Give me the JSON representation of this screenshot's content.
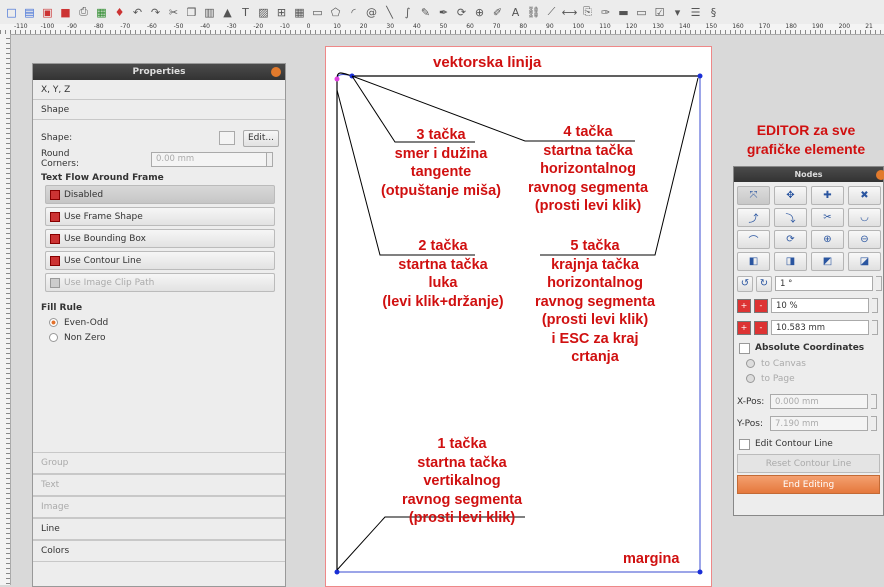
{
  "toolbar": {
    "icons": [
      "new-icon",
      "open-icon",
      "save-icon",
      "close-doc-icon",
      "print-icon",
      "preflight-icon",
      "pdf-icon",
      "undo-icon",
      "redo-icon",
      "cut-icon",
      "copy-icon",
      "paste-icon",
      "select-icon",
      "text-frame-icon",
      "image-frame-icon",
      "render-frame-icon",
      "table-icon",
      "shape-icon",
      "polygon-icon",
      "arc-icon",
      "spiral-icon",
      "line-icon",
      "bezier-icon",
      "freehand-icon",
      "calligraphic-icon",
      "rotate-icon",
      "zoom-icon",
      "edit-content-icon",
      "edit-text-icon",
      "link-frames-icon",
      "unlink-frames-icon",
      "measure-icon",
      "copy-properties-icon",
      "eyedropper-icon",
      "pdf-push-button-icon",
      "pdf-text-field-icon",
      "pdf-checkbox-icon",
      "pdf-combo-icon",
      "pdf-list-icon",
      "pdf-link-icon"
    ]
  },
  "ruler": {
    "top_labels": [
      "-110",
      "-100",
      "-90",
      "-80",
      "-70",
      "-60",
      "-50",
      "-40",
      "-30",
      "-20",
      "-10",
      "0",
      "10",
      "20",
      "30",
      "40",
      "50",
      "60",
      "70",
      "80",
      "90",
      "100",
      "110",
      "120",
      "130",
      "140",
      "150",
      "160",
      "170",
      "180",
      "190",
      "200",
      "21"
    ]
  },
  "properties": {
    "title": "Properties",
    "xyz": "X, Y, Z",
    "shape_section": "Shape",
    "shape_label": "Shape:",
    "edit_button": "Edit...",
    "round_corners_label": "Round Corners:",
    "round_corners_value": "0.00 mm",
    "text_flow_title": "Text Flow Around Frame",
    "text_flow_options": [
      {
        "label": "Disabled",
        "selected": true,
        "enabled": true
      },
      {
        "label": "Use Frame Shape",
        "selected": false,
        "enabled": true
      },
      {
        "label": "Use Bounding Box",
        "selected": false,
        "enabled": true
      },
      {
        "label": "Use Contour Line",
        "selected": false,
        "enabled": true
      },
      {
        "label": "Use Image Clip Path",
        "selected": false,
        "enabled": false
      }
    ],
    "fill_rule_title": "Fill Rule",
    "fill_rules": [
      {
        "label": "Even-Odd",
        "checked": true
      },
      {
        "label": "Non Zero",
        "checked": false
      }
    ],
    "bottom_sections": [
      {
        "label": "Group",
        "enabled": false
      },
      {
        "label": "Text",
        "enabled": false
      },
      {
        "label": "Image",
        "enabled": false
      },
      {
        "label": "Line",
        "enabled": true
      },
      {
        "label": "Colors",
        "enabled": true
      }
    ]
  },
  "annotations": {
    "title": "vektorska linija",
    "a3": "3 tačka\nsmer i dužina\ntangente\n(otpuštanje miša)",
    "a4": "4 tačka\nstartna tačka\nhorizontalnog\nravnog segmenta\n(prosti levi klik)",
    "a2": "2 tačka\nstartna tačka\nluka\n(levi klik+držanje)",
    "a5": "5 tačka\nkrajnja tačka\nhorizontalnog\nravnog segmenta\n(prosti levi klik)\ni ESC za kraj\ncrtanja",
    "a1": "1 tačka\nstartna tačka\nvertikalnog\nravnog segmenta\n(prosti levi klik)",
    "margina": "margina",
    "editor": "EDITOR za sve\ngrafičke elemente"
  },
  "nodes": {
    "title": "Nodes",
    "tool_buttons": [
      "move-nodes-icon",
      "move-control-icon",
      "add-node-icon",
      "delete-node-icon",
      "reset-control-icon",
      "reset-control-alt-icon",
      "split-path-icon",
      "smooth-node-icon",
      "cusp-node-icon",
      "symmetric-node-icon",
      "asymmetric-node-icon",
      "close-path-icon",
      "mirror-horizontal-icon",
      "mirror-vertical-icon",
      "shear-left-icon",
      "shear-right-icon"
    ],
    "rotate_value": "1 °",
    "scale_value": "10 %",
    "size_value": "10.583 mm",
    "absolute_coords": "Absolute Coordinates",
    "to_canvas": "to Canvas",
    "to_page": "to Page",
    "xpos_label": "X-Pos:",
    "xpos_value": "0.000 mm",
    "ypos_label": "Y-Pos:",
    "ypos_value": "7.190 mm",
    "edit_contour": "Edit Contour Line",
    "reset_contour": "Reset Contour Line",
    "end_editing": "End Editing"
  }
}
